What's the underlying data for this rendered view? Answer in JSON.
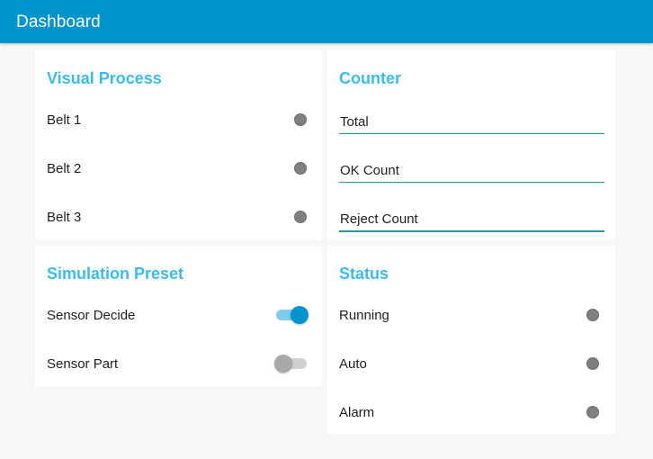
{
  "header": {
    "title": "Dashboard"
  },
  "visual_process": {
    "title": "Visual Process",
    "items": [
      {
        "label": "Belt 1",
        "led_color": "#7f7f7f"
      },
      {
        "label": "Belt 2",
        "led_color": "#7f7f7f"
      },
      {
        "label": "Belt 3",
        "led_color": "#7f7f7f"
      }
    ]
  },
  "counter": {
    "title": "Counter",
    "fields": [
      {
        "label": "Total"
      },
      {
        "label": "OK Count"
      },
      {
        "label": "Reject Count"
      }
    ]
  },
  "simulation_preset": {
    "title": "Simulation Preset",
    "switches": [
      {
        "label": "Sensor Decide",
        "state": "on"
      },
      {
        "label": "Sensor Part",
        "state": "off"
      }
    ]
  },
  "status": {
    "title": "Status",
    "items": [
      {
        "label": "Running",
        "led_color": "#7f7f7f"
      },
      {
        "label": "Auto",
        "led_color": "#7f7f7f"
      },
      {
        "label": "Alarm",
        "led_color": "#7f7f7f"
      }
    ]
  },
  "colors": {
    "header_bg": "#0094ce",
    "card_title": "#3cbcee",
    "field_underline": "#1d9aa8",
    "switch_on": "#0094ce",
    "led_off": "#7f7f7f"
  }
}
